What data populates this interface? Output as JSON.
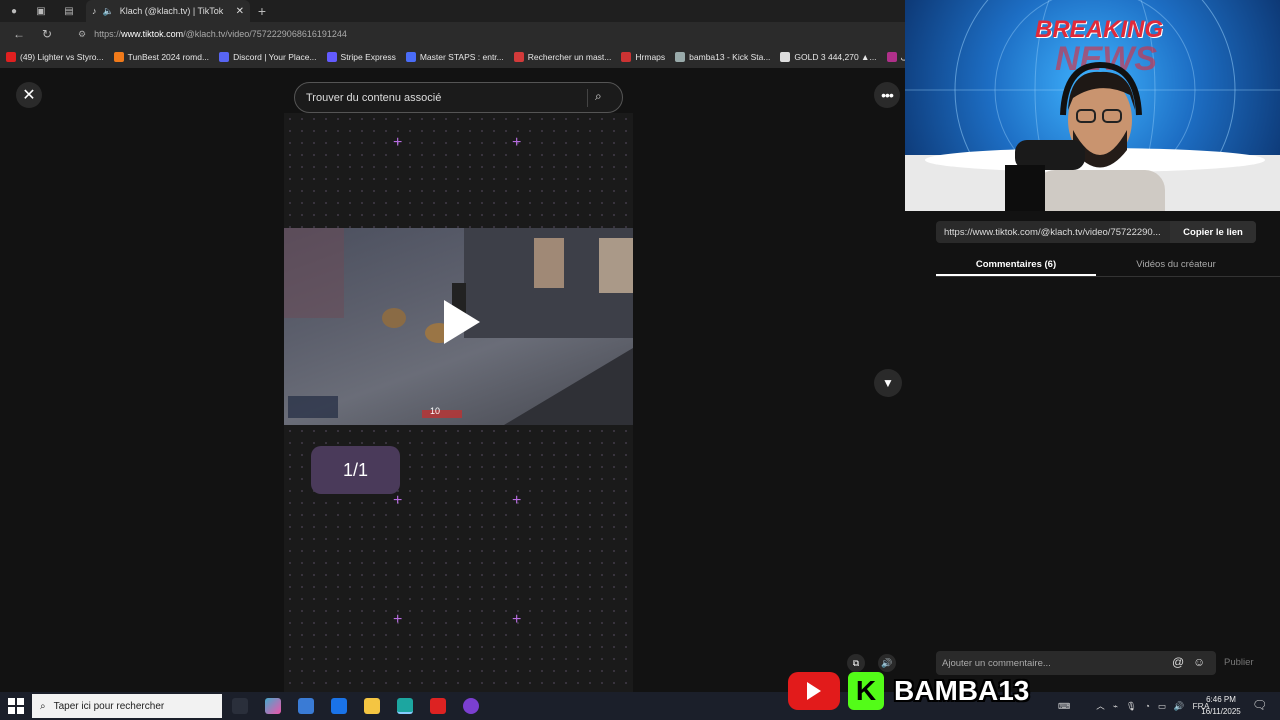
{
  "browser": {
    "tab_title": "Klach (@klach.tv) | TikTok",
    "url_prefix": "https://",
    "url_domain": "www.tiktok.com",
    "url_path": "/@klach.tv/video/7572229068616191244",
    "bookmarks": [
      {
        "label": "(49) Lighter vs Styro...",
        "color": "#e02020"
      },
      {
        "label": "TunBest 2024 romd...",
        "color": "#f07a1a"
      },
      {
        "label": "Discord | Your Place...",
        "color": "#5865f2"
      },
      {
        "label": "Stripe Express",
        "color": "#635bff"
      },
      {
        "label": "Master STAPS : entr...",
        "color": "#4a6cf7"
      },
      {
        "label": "Rechercher un mast...",
        "color": "#d23a3a"
      },
      {
        "label": "Hrmaps",
        "color": "#c33"
      },
      {
        "label": "bamba13 - Kick Sta...",
        "color": "#9aa"
      },
      {
        "label": "GOLD 3 444,270 ▲...",
        "color": "#ddd"
      },
      {
        "label": "أف... | Shoft",
        "color": "#b0308a"
      }
    ]
  },
  "page": {
    "search_placeholder": "Trouver du contenu associé",
    "photo_counter": "1/1",
    "video_counter": "10"
  },
  "panel": {
    "link": "https://www.tiktok.com/@klach.tv/video/75722290...",
    "copy_label": "Copier le lien",
    "tabs": [
      {
        "label": "Commentaires (6)",
        "active": true
      },
      {
        "label": "Vidéos du créateur",
        "active": false
      }
    ],
    "comment_placeholder": "Ajouter un commentaire...",
    "publish_label": "Publier"
  },
  "webcam": {
    "banner_top": "BREAKING",
    "banner_bottom": "NEWS"
  },
  "overlay": {
    "channel_name": "BAMBA13"
  },
  "taskbar": {
    "search_placeholder": "Taper ici pour rechercher",
    "language": "FRA",
    "time": "6:46 PM",
    "date": "16/11/2025"
  }
}
